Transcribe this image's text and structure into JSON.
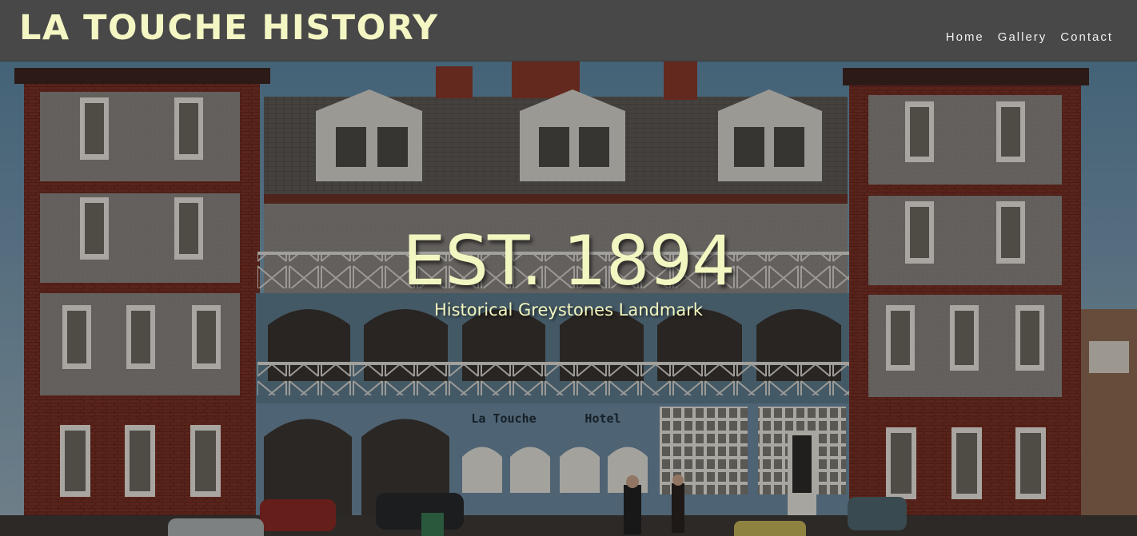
{
  "header": {
    "site_title": "LA TOUCHE HISTORY",
    "nav": [
      "Home",
      "Gallery",
      "Contact"
    ]
  },
  "hero": {
    "heading": "EST. 1894",
    "subheading": "Historical Greystones Landmark",
    "hotel_sign_left": "La Touche",
    "hotel_sign_right": "Hotel"
  },
  "colors": {
    "header_bg": "#484848",
    "title_accent": "#f4f7c3",
    "nav_text": "#f0f0f0"
  }
}
